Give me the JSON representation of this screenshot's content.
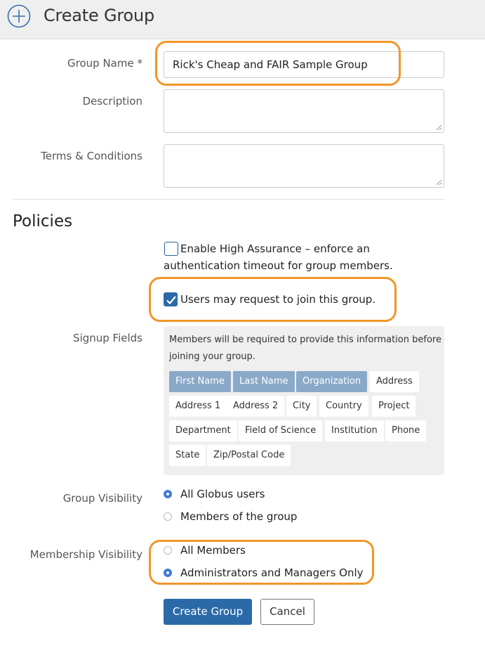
{
  "header": {
    "title": "Create Group",
    "icon": "plus-circle-icon"
  },
  "form": {
    "group_name": {
      "label": "Group Name *",
      "value": "Rick's Cheap and FAIR Sample Group"
    },
    "description": {
      "label": "Description",
      "value": ""
    },
    "terms": {
      "label": "Terms & Conditions",
      "value": ""
    }
  },
  "policies": {
    "title": "Policies",
    "high_assurance": {
      "label": "Enable High Assurance – enforce an authentication timeout for group members.",
      "checked": false
    },
    "request_join": {
      "label": "Users may request to join this group.",
      "checked": true
    },
    "signup": {
      "label": "Signup Fields",
      "intro": "Members will be required to provide this information before joining your group.",
      "fields": [
        {
          "label": "First Name",
          "selected": true
        },
        {
          "label": "Last Name",
          "selected": true
        },
        {
          "label": "Organization",
          "selected": true
        },
        {
          "label": "Address",
          "selected": false
        },
        {
          "label": "Address 1",
          "selected": false
        },
        {
          "label": "Address 2",
          "selected": false
        },
        {
          "label": "City",
          "selected": false
        },
        {
          "label": "Country",
          "selected": false
        },
        {
          "label": "Project",
          "selected": false
        },
        {
          "label": "Department",
          "selected": false
        },
        {
          "label": "Field of Science",
          "selected": false
        },
        {
          "label": "Institution",
          "selected": false
        },
        {
          "label": "Phone",
          "selected": false
        },
        {
          "label": "State",
          "selected": false
        },
        {
          "label": "Zip/Postal Code",
          "selected": false
        }
      ]
    },
    "group_visibility": {
      "label": "Group Visibility",
      "options": [
        {
          "label": "All Globus users",
          "selected": true
        },
        {
          "label": "Members of the group",
          "selected": false
        }
      ]
    },
    "membership_visibility": {
      "label": "Membership Visibility",
      "options": [
        {
          "label": "All Members",
          "selected": false
        },
        {
          "label": "Administrators and Managers Only",
          "selected": true
        }
      ]
    }
  },
  "actions": {
    "create": "Create Group",
    "cancel": "Cancel"
  },
  "colors": {
    "accent": "#2b6aa8",
    "chip_selected": "#8aa9c8",
    "highlight": "#f0962a",
    "radio_selected": "#3f7bd6"
  }
}
